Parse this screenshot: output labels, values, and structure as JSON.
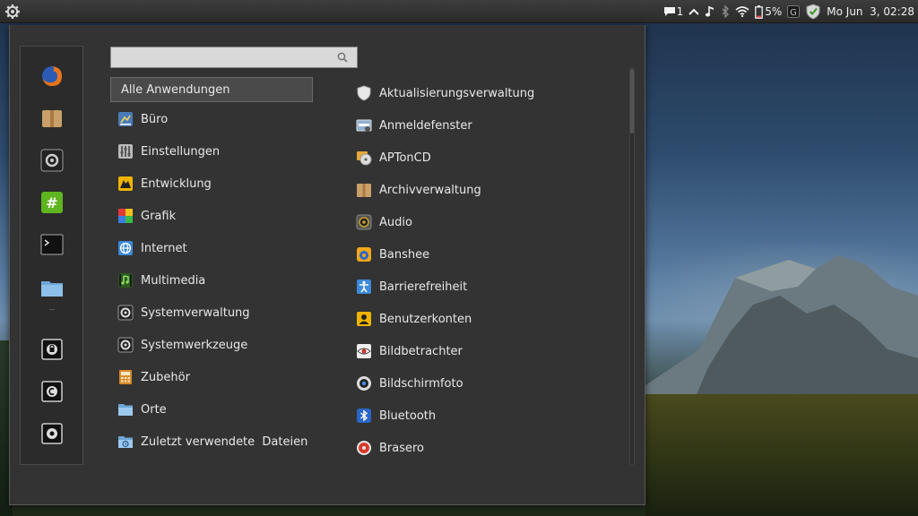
{
  "panel": {
    "notification_count": "1",
    "battery": "5%",
    "clock": "Mo Jun  3, 02:28"
  },
  "search": {
    "value": "",
    "placeholder": ""
  },
  "categories": [
    {
      "label": "Alle Anwendungen",
      "icon": "none",
      "selected": true
    },
    {
      "label": "Büro",
      "icon": "office-icon"
    },
    {
      "label": "Einstellungen",
      "icon": "settings-icon"
    },
    {
      "label": "Entwicklung",
      "icon": "development-icon"
    },
    {
      "label": "Grafik",
      "icon": "graphics-icon"
    },
    {
      "label": "Internet",
      "icon": "internet-icon"
    },
    {
      "label": "Multimedia",
      "icon": "multimedia-icon"
    },
    {
      "label": "Systemverwaltung",
      "icon": "system-admin-icon"
    },
    {
      "label": "Systemwerkzeuge",
      "icon": "system-tools-icon"
    },
    {
      "label": "Zubehör",
      "icon": "accessories-icon"
    },
    {
      "label": "Orte",
      "icon": "folder-icon"
    },
    {
      "label": "Zuletzt verwendete  Dateien",
      "icon": "recent-files-icon"
    }
  ],
  "apps": [
    {
      "label": "Aktualisierungsverwaltung",
      "icon": "update-shield-icon"
    },
    {
      "label": "Anmeldefenster",
      "icon": "login-window-icon"
    },
    {
      "label": "APTonCD",
      "icon": "aptoncd-icon"
    },
    {
      "label": "Archivverwaltung",
      "icon": "archive-icon"
    },
    {
      "label": "Audio",
      "icon": "audio-icon"
    },
    {
      "label": "Banshee",
      "icon": "banshee-icon"
    },
    {
      "label": "Barrierefreiheit",
      "icon": "accessibility-icon"
    },
    {
      "label": "Benutzerkonten",
      "icon": "user-accounts-icon"
    },
    {
      "label": "Bildbetrachter",
      "icon": "image-viewer-icon"
    },
    {
      "label": "Bildschirmfoto",
      "icon": "screenshot-icon"
    },
    {
      "label": "Bluetooth",
      "icon": "bluetooth-icon"
    },
    {
      "label": "Brasero",
      "icon": "brasero-icon"
    }
  ],
  "favorites": [
    {
      "name": "firefox-icon"
    },
    {
      "name": "package-icon"
    },
    {
      "name": "system-settings-icon"
    },
    {
      "name": "hexchat-icon"
    },
    {
      "name": "terminal-icon"
    },
    {
      "name": "files-icon"
    },
    {
      "name": "lock-screen-icon"
    },
    {
      "name": "logout-icon"
    },
    {
      "name": "shutdown-icon"
    }
  ],
  "colors": {
    "menu_bg": "#333333",
    "selected_bg": "#4a4a4a",
    "panel_bg": "#2f2f2f"
  }
}
